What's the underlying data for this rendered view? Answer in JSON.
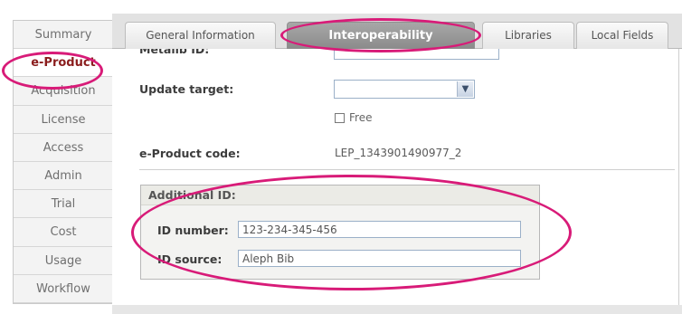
{
  "nav": {
    "items": [
      {
        "label": "Summary"
      },
      {
        "label": "e-Product"
      },
      {
        "label": "Acquisition"
      },
      {
        "label": "License"
      },
      {
        "label": "Access"
      },
      {
        "label": "Admin"
      },
      {
        "label": "Trial"
      },
      {
        "label": "Cost"
      },
      {
        "label": "Usage"
      },
      {
        "label": "Workflow"
      }
    ],
    "active_index": 1
  },
  "tabs": [
    {
      "label": "General Information"
    },
    {
      "label": "Interoperability"
    },
    {
      "label": "Libraries"
    },
    {
      "label": "Local Fields"
    }
  ],
  "active_tab": "Interoperability",
  "form": {
    "metalib_label": "Metalib ID:",
    "update_target_label": "Update target:",
    "update_target_value": "",
    "free_label": "Free",
    "free_checked": false,
    "eproduct_code_label": "e-Product code:",
    "eproduct_code_value": "LEP_1343901490977_2"
  },
  "additional_id": {
    "legend": "Additional ID:",
    "id_number_label": "ID number:",
    "id_number_value": "123-234-345-456",
    "id_source_label": "ID source:",
    "id_source_value": "Aleph Bib"
  },
  "colors": {
    "annotation": "#d81b78",
    "active_nav_text": "#8a1d1d",
    "active_tab": "#999999"
  }
}
